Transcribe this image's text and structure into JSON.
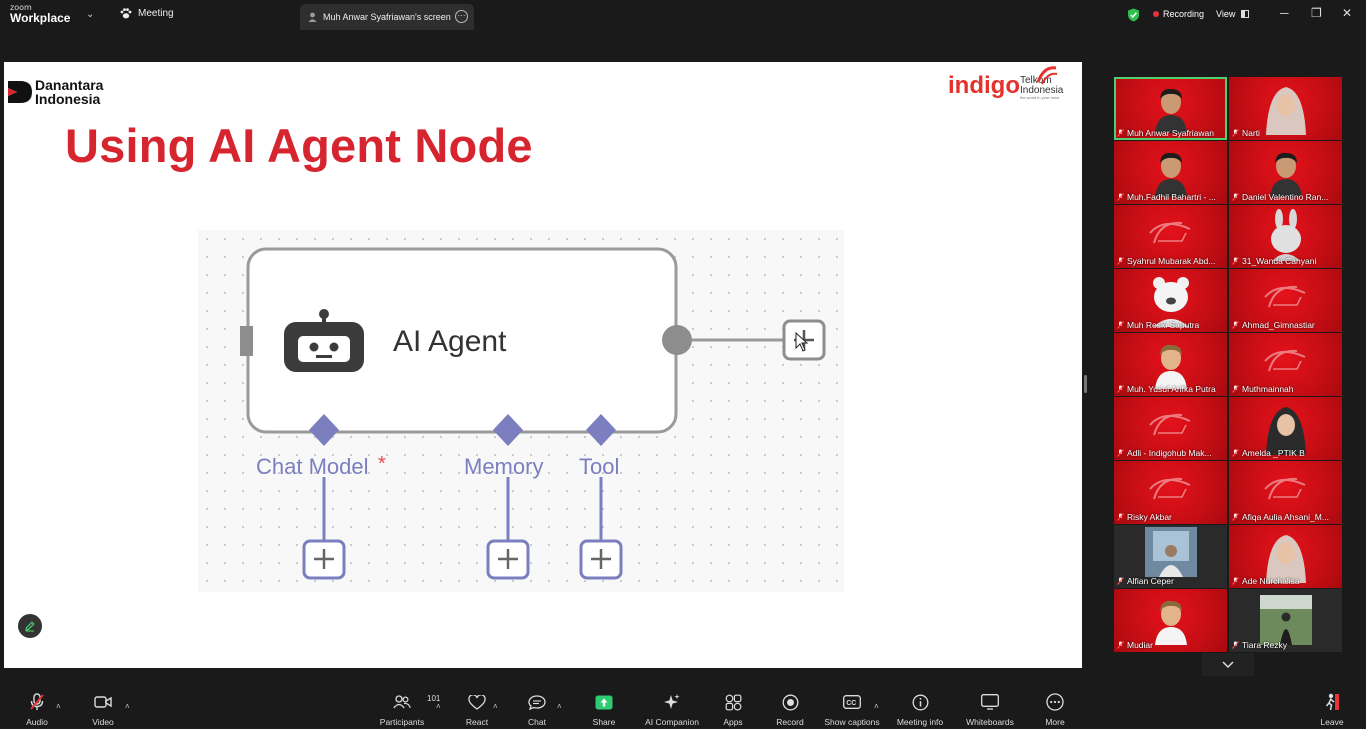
{
  "titlebar": {
    "brand_small": "zoom",
    "brand_large": "Workplace",
    "meeting_tab": "Meeting",
    "screen_tab": "Muh Anwar Syafriawan's screen",
    "recording": "Recording",
    "view": "View"
  },
  "slide": {
    "org_logo_line1": "Danantara",
    "org_logo_line2": "Indonesia",
    "title": "Using AI Agent Node",
    "partner_logo": "indigo",
    "telkom_line1": "Telkom",
    "telkom_line2": "Indonesia",
    "telkom_tagline": "the world in your hand",
    "diagram": {
      "node_label": "AI Agent",
      "ports": [
        {
          "label": "Chat Model",
          "required_mark": "*"
        },
        {
          "label": "Memory",
          "required_mark": ""
        },
        {
          "label": "Tool",
          "required_mark": ""
        }
      ]
    }
  },
  "participants": [
    {
      "name": "Muh Anwar Syafriawan",
      "video": "face",
      "active": true
    },
    {
      "name": "Narti",
      "video": "hijab"
    },
    {
      "name": "Muh.Fadhil Bahartri - ...",
      "video": "face"
    },
    {
      "name": "Daniel Valentino Ran...",
      "video": "face"
    },
    {
      "name": "Syahrul Mubarak Abd...",
      "video": "none"
    },
    {
      "name": "31_Wanda Cahyani",
      "video": "bunny"
    },
    {
      "name": "Muh Reski Saputra",
      "video": "bear"
    },
    {
      "name": "Ahmad_Gimnastiar",
      "video": "none"
    },
    {
      "name": "Muh. Yusuf Arifka Putra",
      "video": "avatar"
    },
    {
      "name": "Muthmainnah",
      "video": "none"
    },
    {
      "name": "Adli - Indigohub Mak...",
      "video": "none"
    },
    {
      "name": "Amelda _PTIK B",
      "video": "avatar-hijab"
    },
    {
      "name": "Risky Akbar",
      "video": "none"
    },
    {
      "name": "Afiqa Aulia Ahsani_M...",
      "video": "none"
    },
    {
      "name": "Alfian Ceper",
      "video": "photo-dark"
    },
    {
      "name": "Ade Nurchalisa",
      "video": "hijab"
    },
    {
      "name": "Mudiar",
      "video": "avatar"
    },
    {
      "name": "Tiara Rezky",
      "video": "photo-outdoor"
    }
  ],
  "toolbar": {
    "audio": "Audio",
    "video": "Video",
    "participants": "Participants",
    "participants_count": "101",
    "react": "React",
    "chat": "Chat",
    "share": "Share",
    "ai_companion": "AI Companion",
    "apps": "Apps",
    "record": "Record",
    "show_captions": "Show captions",
    "meeting_info": "Meeting info",
    "whiteboards": "Whiteboards",
    "more": "More",
    "leave": "Leave"
  },
  "colors": {
    "slide_title": "#d6252f",
    "tile_red": "#d10f17",
    "node_port": "#7b7fbf",
    "share_green": "#2ecc71",
    "active_speaker": "#4fd06c"
  }
}
